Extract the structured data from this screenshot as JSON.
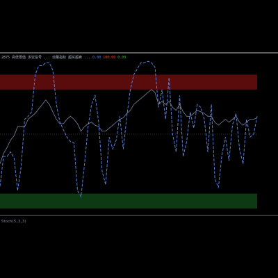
{
  "window": {
    "footer_label": "Stoch(5,3,3)"
  },
  "indicator_header": {
    "segments": [
      {
        "text": "2875 高低限值 多空信号 ... 动量指标 超买超卖 ...",
        "color": "#aeb7c6"
      },
      {
        "text": "0.00",
        "color": "#4f7dff"
      },
      {
        "text": "100.00",
        "color": "#ff3b30"
      },
      {
        "text": "0.00",
        "color": "#2fbf2f"
      }
    ]
  },
  "colors": {
    "background": "#000000",
    "overbought_zone": "#5a0c0c",
    "oversold_zone": "#0d3a12",
    "main_line": "#5b7fd8",
    "signal_line": "#7a86a4",
    "midline": "#6b6b6b",
    "frame": "#c0c0c0"
  },
  "chart_data": {
    "type": "line",
    "xlabel": "",
    "ylabel": "",
    "ylim": [
      0,
      100
    ],
    "zones": [
      {
        "name": "overbought",
        "from": 80,
        "to": 90
      },
      {
        "name": "oversold",
        "from": 0,
        "to": 10
      }
    ],
    "reference_lines": [
      50
    ],
    "x": [
      0,
      1,
      2,
      3,
      4,
      5,
      6,
      7,
      8,
      9,
      10,
      11,
      12,
      13,
      14,
      15,
      16,
      17,
      18,
      19,
      20,
      21,
      22,
      23,
      24,
      25,
      26,
      27,
      28,
      29,
      30,
      31,
      32,
      33,
      34,
      35,
      36,
      37,
      38,
      39,
      40,
      41,
      42,
      43,
      44,
      45,
      46,
      47,
      48,
      49,
      50,
      51,
      52,
      53,
      54,
      55,
      56,
      57,
      58,
      59,
      60,
      61,
      62,
      63,
      64,
      65,
      66,
      67,
      68,
      69,
      70,
      71,
      72,
      73
    ],
    "series": [
      {
        "values": [
          15,
          35,
          35,
          38,
          34,
          12,
          28,
          60,
          62,
          65,
          90,
          96,
          96,
          98,
          98,
          93,
          70,
          58,
          53,
          48,
          45,
          44,
          12,
          8,
          30,
          55,
          70,
          76,
          58,
          25,
          16,
          48,
          40,
          46,
          62,
          40,
          62,
          80,
          90,
          94,
          98,
          98,
          99,
          98,
          95,
          68,
          80,
          60,
          88,
          50,
          38,
          76,
          35,
          45,
          65,
          54,
          70,
          68,
          60,
          38,
          70,
          20,
          14,
          36,
          48,
          32,
          56,
          64,
          40,
          30,
          60,
          48,
          50,
          62
        ]
      },
      {
        "values": [
          30,
          37,
          41,
          46,
          49,
          55,
          55,
          55,
          60,
          62,
          64,
          67,
          70,
          73,
          70,
          65,
          60,
          57,
          57,
          60,
          62,
          60,
          57,
          52,
          55,
          57,
          58,
          56,
          55,
          52,
          52,
          54,
          56,
          58,
          60,
          61,
          64,
          66,
          70,
          72,
          74,
          76,
          78,
          80,
          78,
          70,
          72,
          70,
          72,
          68,
          66,
          70,
          65,
          62,
          62,
          64,
          66,
          65,
          64,
          62,
          62,
          58,
          56,
          58,
          60,
          58,
          60,
          62,
          58,
          56,
          58,
          60,
          60,
          61
        ]
      }
    ]
  }
}
